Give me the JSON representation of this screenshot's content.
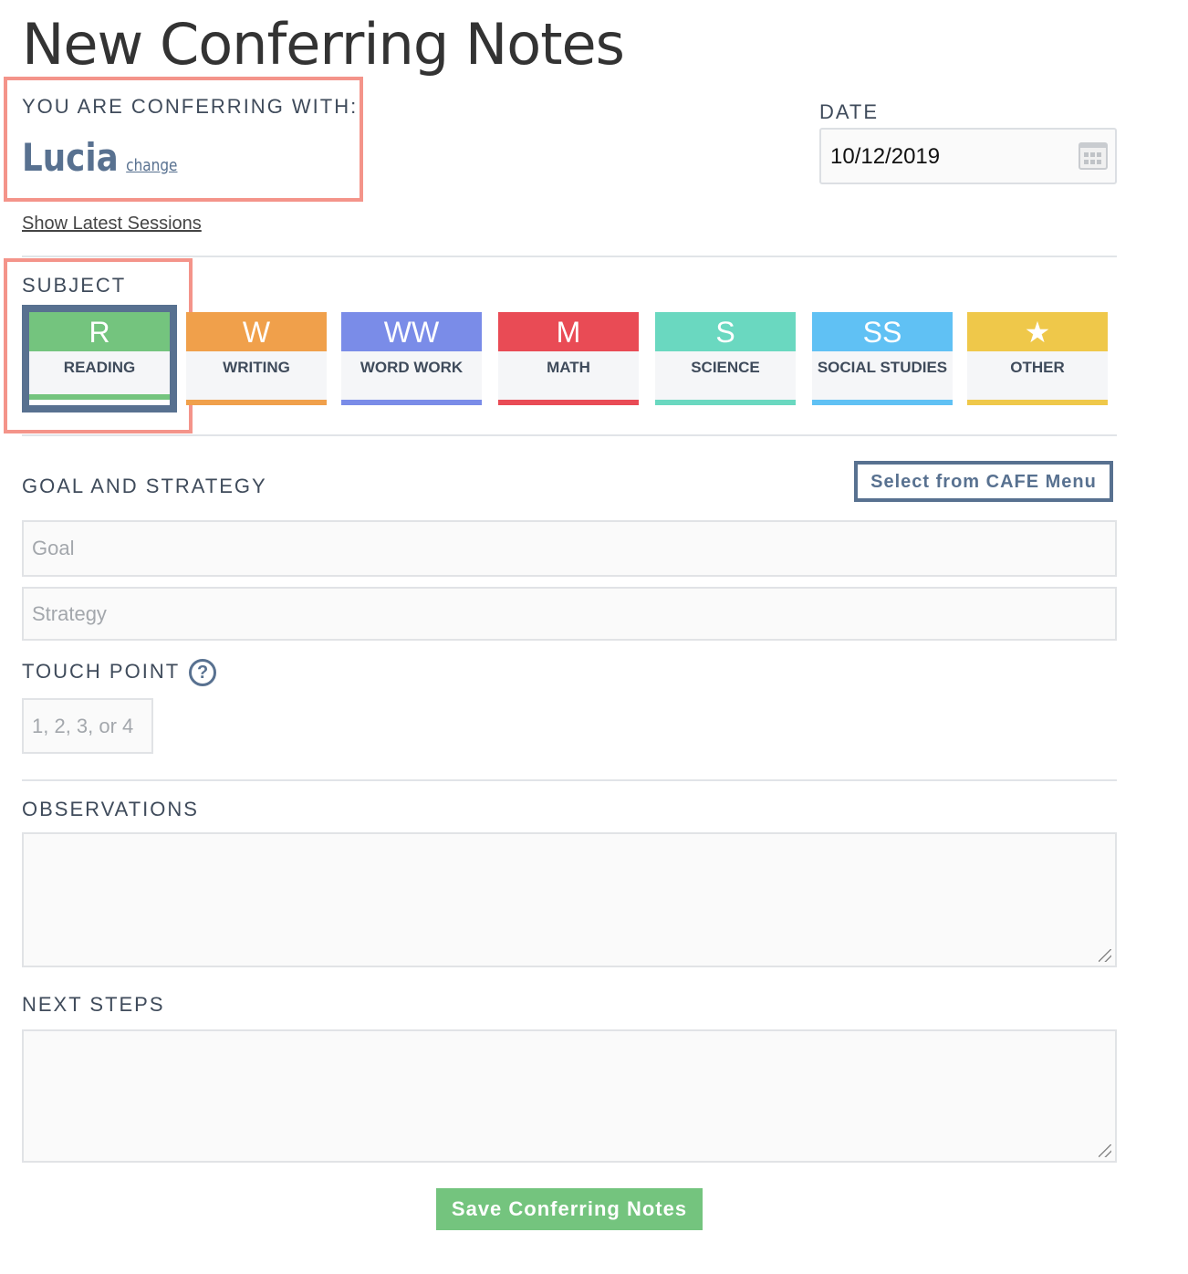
{
  "page_title": "New Conferring Notes",
  "conferring": {
    "label": "YOU ARE CONFERRING WITH:",
    "student": "Lucia",
    "change_label": "change"
  },
  "date": {
    "label": "DATE",
    "value": "10/12/2019",
    "icon": "calendar-icon"
  },
  "show_latest": "Show Latest Sessions",
  "subject": {
    "label": "SUBJECT",
    "selected": "READING",
    "items": [
      {
        "abbr": "R",
        "name": "READING",
        "color": "#74c47e"
      },
      {
        "abbr": "W",
        "name": "WRITING",
        "color": "#f0a04b"
      },
      {
        "abbr": "WW",
        "name": "WORD WORK",
        "color": "#7a8ce8"
      },
      {
        "abbr": "M",
        "name": "MATH",
        "color": "#e94b55"
      },
      {
        "abbr": "S",
        "name": "SCIENCE",
        "color": "#6ad8c0"
      },
      {
        "abbr": "SS",
        "name": "SOCIAL STUDIES",
        "color": "#60c1f4"
      },
      {
        "abbr": "★",
        "name": "OTHER",
        "color": "#efc84a"
      }
    ]
  },
  "goal_strategy": {
    "label": "GOAL AND STRATEGY",
    "cafe_button": "Select from CAFE Menu",
    "goal_placeholder": "Goal",
    "strategy_placeholder": "Strategy"
  },
  "touch_point": {
    "label": "TOUCH POINT",
    "help": "?",
    "placeholder": "1, 2, 3, or 4"
  },
  "observations": {
    "label": "OBSERVATIONS"
  },
  "next_steps": {
    "label": "NEXT STEPS"
  },
  "save_button": "Save Conferring Notes",
  "colors": {
    "accent": "#587190",
    "save": "#74c47e",
    "annotation": "#f4948a"
  }
}
